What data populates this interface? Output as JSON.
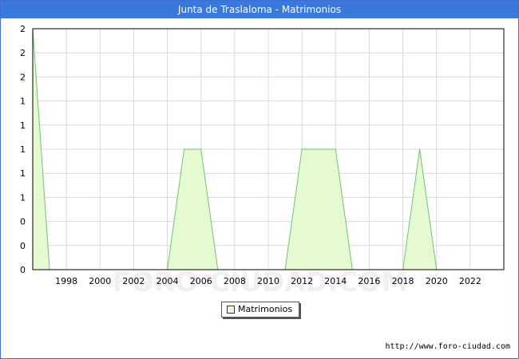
{
  "header": {
    "title": "Junta de Traslaloma - Matrimonios"
  },
  "source": "http://www.foro-ciudad.com",
  "watermark": "FORO-CIUDAD.COM",
  "colors": {
    "titlebar": "#3a78dc",
    "fill": "#e6fad2",
    "line": "#6fc37a",
    "grid": "#d8d8d8"
  },
  "chart_data": {
    "type": "area",
    "title": "Junta de Traslaloma - Matrimonios",
    "xlabel": "",
    "ylabel": "",
    "x": [
      1996,
      1997,
      1998,
      1999,
      2000,
      2001,
      2002,
      2003,
      2004,
      2005,
      2006,
      2007,
      2008,
      2009,
      2010,
      2011,
      2012,
      2013,
      2014,
      2015,
      2016,
      2017,
      2018,
      2019,
      2020,
      2021,
      2022,
      2023
    ],
    "series": [
      {
        "name": "Matrimonios",
        "values": [
          2,
          0,
          0,
          0,
          0,
          0,
          0,
          0,
          0,
          1,
          1,
          0,
          0,
          0,
          0,
          0,
          1,
          1,
          1,
          0,
          0,
          0,
          0,
          1,
          0,
          0,
          0,
          0
        ]
      }
    ],
    "xlim": [
      1996,
      2024
    ],
    "ylim": [
      0,
      2
    ],
    "x_tick_values": [
      1998,
      2000,
      2002,
      2004,
      2006,
      2008,
      2010,
      2012,
      2014,
      2016,
      2018,
      2020,
      2022
    ],
    "x_tick_labels": [
      "1998",
      "2000",
      "2002",
      "2004",
      "2006",
      "2008",
      "2010",
      "2012",
      "2014",
      "2016",
      "2018",
      "2020",
      "2022"
    ],
    "y_tick_values": [
      0,
      0.2,
      0.4,
      0.6,
      0.8,
      1.0,
      1.2,
      1.4,
      1.6,
      1.8,
      2.0
    ],
    "y_tick_labels": [
      "0",
      "0",
      "0",
      "1",
      "1",
      "1",
      "1",
      "1",
      "2",
      "2",
      "2"
    ],
    "grid": true,
    "legend": {
      "position": "bottom-center",
      "entries": [
        "Matrimonios"
      ]
    }
  }
}
